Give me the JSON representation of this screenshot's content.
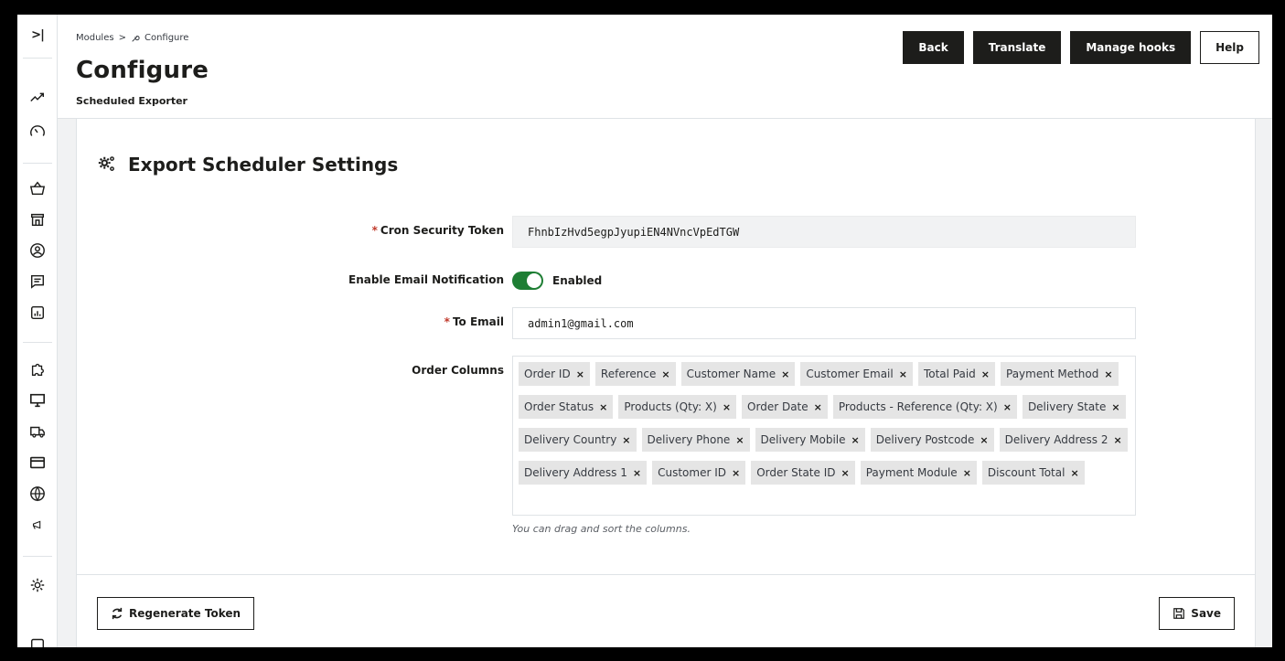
{
  "breadcrumb": {
    "parent": "Modules",
    "separator": ">",
    "current": "Configure"
  },
  "header": {
    "title": "Configure",
    "subtitle": "Scheduled Exporter"
  },
  "toolbar": {
    "back": "Back",
    "translate": "Translate",
    "manage_hooks": "Manage hooks",
    "help": "Help"
  },
  "sidebar": {
    "toggle_glyph": ">|",
    "icons": [
      "collapse-icon",
      "trending-icon",
      "speed-icon",
      "basket-icon",
      "store-icon",
      "user-circle-icon",
      "message-icon",
      "chart-box-icon",
      "puzzle-icon",
      "monitor-icon",
      "truck-icon",
      "card-icon",
      "globe-icon",
      "megaphone-icon",
      "settings-icon",
      "extra-icon"
    ]
  },
  "card": {
    "title": "Export Scheduler Settings"
  },
  "form": {
    "cron_token": {
      "required": "*",
      "label": "Cron Security Token",
      "value": "FhnbIzHvd5egpJyupiEN4NVncVpEdTGW"
    },
    "email_notify": {
      "label": "Enable Email Notification",
      "state": "Enabled",
      "on": true
    },
    "to_email": {
      "required": "*",
      "label": "To Email",
      "value": "admin1@gmail.com"
    },
    "order_columns": {
      "label": "Order Columns",
      "remove_glyph": "×",
      "rows": [
        [
          "Order ID",
          "Reference",
          "Customer Name",
          "Customer Email",
          "Total Paid",
          "Payment Method"
        ],
        [
          "Order Status",
          "Products (Qty: X)",
          "Order Date",
          "Products - Reference (Qty: X)",
          "Delivery State"
        ],
        [
          "Delivery Country",
          "Delivery Phone",
          "Delivery Mobile",
          "Delivery Postcode",
          "Delivery Address 2"
        ],
        [
          "Delivery Address 1",
          "Customer ID",
          "Order State ID",
          "Payment Module",
          "Discount Total"
        ]
      ],
      "help": "You can drag and sort the columns."
    }
  },
  "footer": {
    "regenerate": "Regenerate Token",
    "save": "Save"
  },
  "colors": {
    "toggle_on": "#1e7e34",
    "required": "#c0392b",
    "dark": "#1d1d1b"
  }
}
